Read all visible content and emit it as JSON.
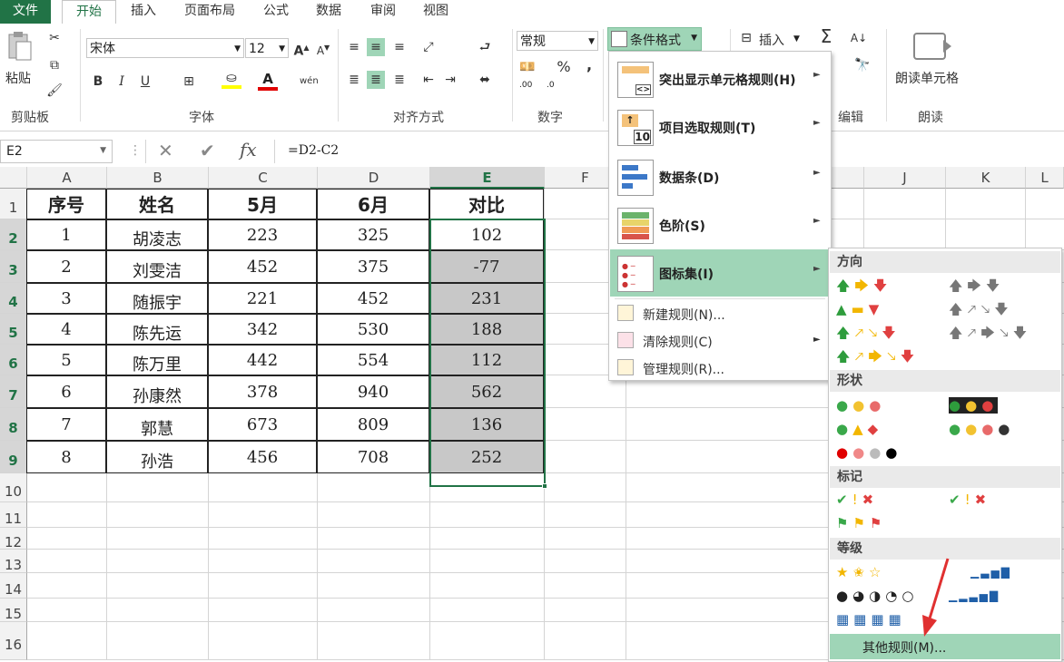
{
  "ribbon_tabs": [
    "文件",
    "开始",
    "插入",
    "页面布局",
    "公式",
    "数据",
    "审阅",
    "视图"
  ],
  "clipboard": {
    "paste_label": "粘贴",
    "group_label": "剪贴板"
  },
  "font": {
    "name": "宋体",
    "size": "12",
    "group_label": "字体",
    "bold": "B",
    "italic": "I",
    "underline": "U",
    "phonetic": "wén"
  },
  "alignment": {
    "group_label": "对齐方式"
  },
  "number": {
    "format": "常规",
    "group_label": "数字",
    "percent": "%",
    "comma": ",",
    "inc_decimal": ".00",
    "dec_decimal": ".0"
  },
  "styles": {
    "conditional_format_label": "条件格式"
  },
  "cells": {
    "insert_label": "插入",
    "group_label": "编辑"
  },
  "read_aloud": {
    "label": "朗读单元格",
    "group_label": "朗读"
  },
  "formula_bar": {
    "name_box": "E2",
    "fx": "fx",
    "formula": "=D2-C2"
  },
  "columns": [
    "A",
    "B",
    "C",
    "D",
    "E",
    "F",
    "J",
    "K",
    "L"
  ],
  "row_numbers": [
    "1",
    "2",
    "3",
    "4",
    "5",
    "6",
    "7",
    "8",
    "9",
    "10",
    "11",
    "12",
    "13",
    "14",
    "15",
    "16"
  ],
  "table": {
    "headers": [
      "序号",
      "姓名",
      "5月",
      "6月",
      "对比"
    ],
    "rows": [
      [
        "1",
        "胡凌志",
        "223",
        "325",
        "102"
      ],
      [
        "2",
        "刘雯洁",
        "452",
        "375",
        "-77"
      ],
      [
        "3",
        "随振宇",
        "221",
        "452",
        "231"
      ],
      [
        "4",
        "陈先运",
        "342",
        "530",
        "188"
      ],
      [
        "5",
        "陈万里",
        "442",
        "554",
        "112"
      ],
      [
        "6",
        "孙康然",
        "378",
        "940",
        "562"
      ],
      [
        "7",
        "郭慧",
        "673",
        "809",
        "136"
      ],
      [
        "8",
        "孙浩",
        "456",
        "708",
        "252"
      ]
    ]
  },
  "cf_menu": {
    "items": [
      {
        "label": "突出显示单元格规则(H)"
      },
      {
        "label": "项目选取规则(T)"
      },
      {
        "label": "数据条(D)"
      },
      {
        "label": "色阶(S)"
      },
      {
        "label": "图标集(I)"
      }
    ],
    "small_items": [
      {
        "label": "新建规则(N)..."
      },
      {
        "label": "清除规则(C)"
      },
      {
        "label": "管理规则(R)..."
      }
    ],
    "top_ten_number": "10"
  },
  "icon_sets": {
    "sections": [
      "方向",
      "形状",
      "标记",
      "等级"
    ],
    "more_rules": "其他规则(M)..."
  },
  "colors": {
    "excel_green": "#217346",
    "selection_green": "#9fd5b7",
    "grey_fill": "#c8c8c8"
  }
}
